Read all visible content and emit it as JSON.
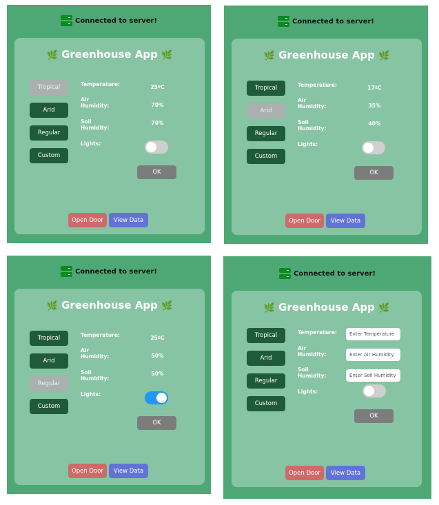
{
  "connection_text": "Connected to server!",
  "app_title": "Greenhouse App",
  "title_icon": "leaf-icon",
  "buttons": {
    "tropical": "Tropical",
    "arid": "Arid",
    "regular": "Regular",
    "custom": "Custom",
    "ok": "OK",
    "open_door": "Open Door",
    "view_data": "View Data"
  },
  "labels": {
    "temperature": "Temperature:",
    "air_humidity": "Air Humidity:",
    "soil_humidity": "Soil Humidity:",
    "lights": "Lights:"
  },
  "placeholders": {
    "temperature": "Enter Temperature",
    "air_humidity": "Enter Air Humidity",
    "soil_humidity": "Enter Soil Humidity"
  },
  "colors": {
    "panel_bg": "#4ea876",
    "card_bg": "#87c4a4",
    "mode_button": "#1f5a39",
    "mode_button_selected": "#a9b0ad",
    "ok_button": "#7a7d7c",
    "open_door_button": "#d06a6a",
    "view_data_button": "#6273d8",
    "toggle_on": "#2196f3"
  },
  "panels": [
    {
      "selected_mode": "tropical",
      "temperature": "25ºC",
      "air_humidity": "70%",
      "soil_humidity": "70%",
      "lights_on": false
    },
    {
      "selected_mode": "arid",
      "temperature": "17ºC",
      "air_humidity": "35%",
      "soil_humidity": "40%",
      "lights_on": false
    },
    {
      "selected_mode": "regular",
      "temperature": "25ºC",
      "air_humidity": "50%",
      "soil_humidity": "50%",
      "lights_on": true
    },
    {
      "selected_mode": "custom_inputs",
      "lights_on": false
    }
  ]
}
